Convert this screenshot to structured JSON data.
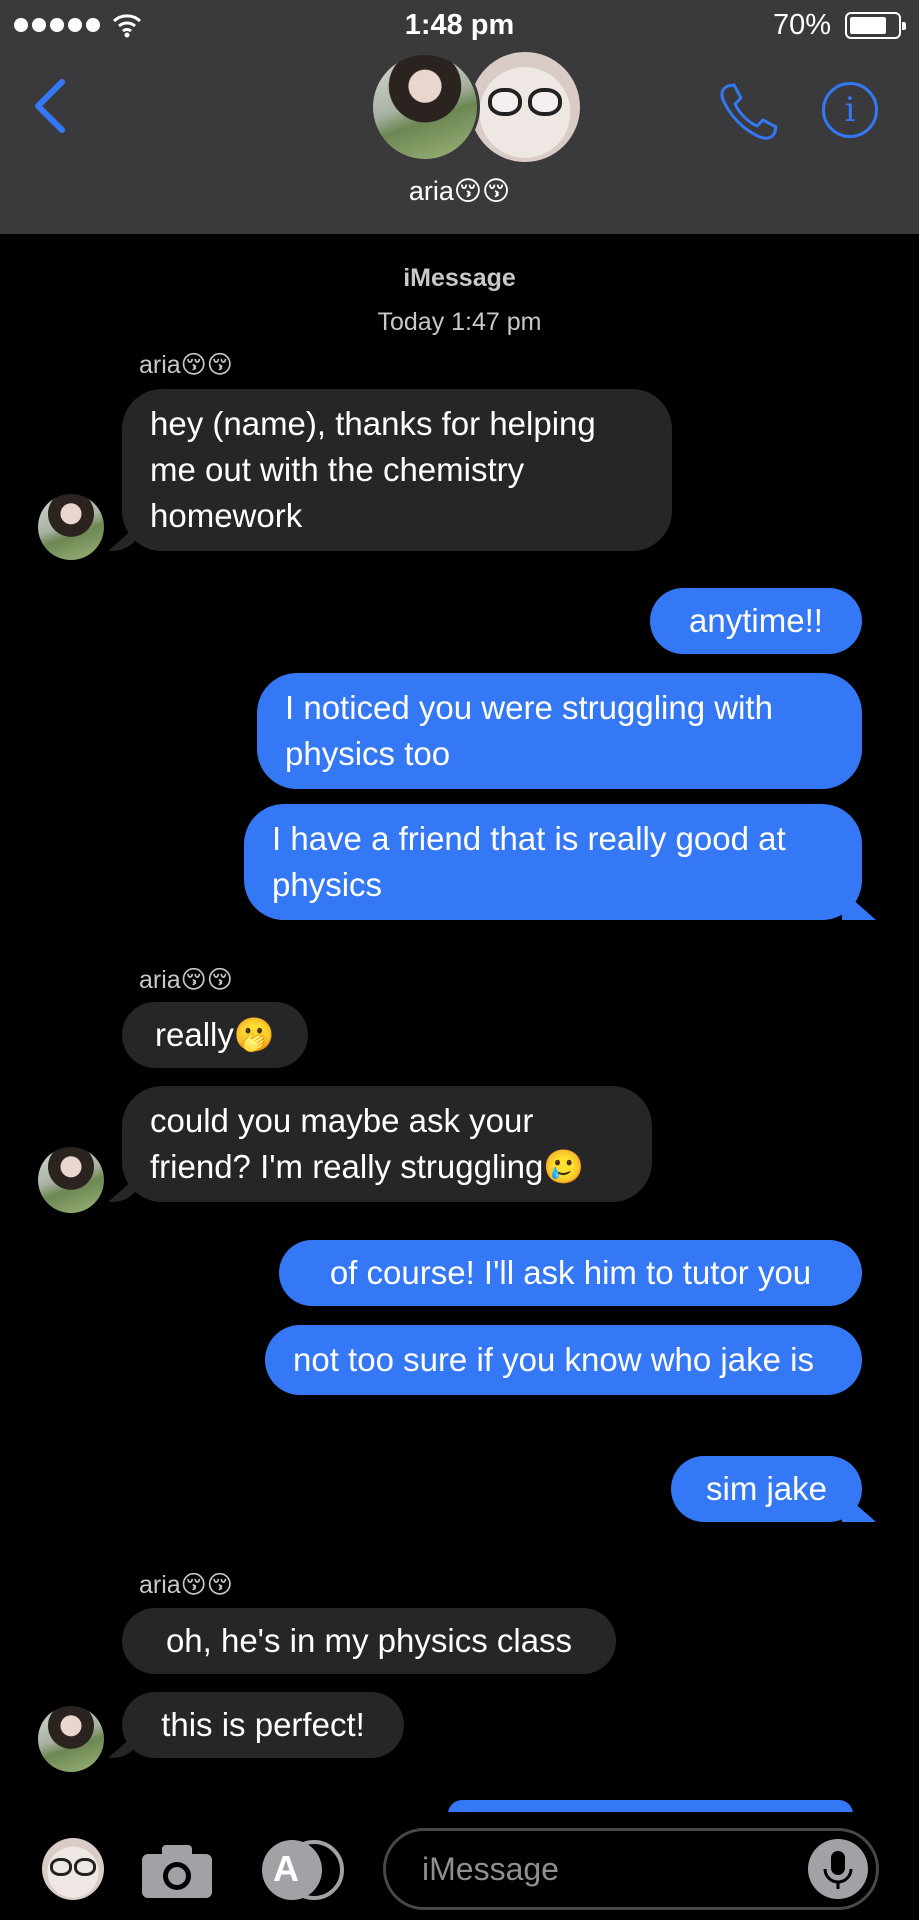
{
  "status_bar": {
    "time": "1:48 pm",
    "battery": "70%",
    "battery_level": 0.7
  },
  "header": {
    "group_name": "aria😚😚"
  },
  "thread": {
    "service": "iMessage",
    "timestamp": "Today 1:47 pm",
    "messages": [
      {
        "sender": "aria😚😚",
        "direction": "in",
        "text": "hey (name), thanks for helping me out with the chemistry homework"
      },
      {
        "direction": "out",
        "text": "anytime!!"
      },
      {
        "direction": "out",
        "text": "I noticed you were struggling with physics too"
      },
      {
        "direction": "out",
        "text": "I have a friend that is really good at physics"
      },
      {
        "sender": "aria😚😚",
        "direction": "in",
        "text": "really🫢"
      },
      {
        "direction": "in",
        "text": "could you maybe ask your friend? I'm really struggling🥲"
      },
      {
        "direction": "out",
        "text": "of course! I'll ask him to tutor you"
      },
      {
        "direction": "out",
        "text": "not too sure if you know who jake is"
      },
      {
        "direction": "out",
        "text": "sim jake"
      },
      {
        "sender": "aria😚😚",
        "direction": "in",
        "text": "oh, he's in my physics class"
      },
      {
        "direction": "in",
        "text": "this is perfect!"
      }
    ]
  },
  "input": {
    "placeholder": "iMessage"
  },
  "colors": {
    "bubble_out": "#3478f6",
    "bubble_in": "#262528",
    "header_bg": "#3a3a3c",
    "accent": "#3478f6"
  },
  "icons": [
    "back-chevron-icon",
    "phone-icon",
    "info-icon",
    "camera-icon",
    "app-store-icon",
    "microphone-icon",
    "wifi-icon",
    "battery-icon"
  ]
}
